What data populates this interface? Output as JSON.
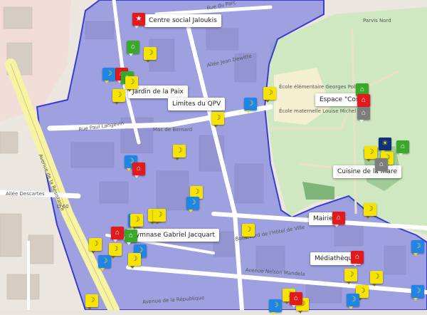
{
  "colors": {
    "zone_fill": "#5b5fe0",
    "park": "#cfe8c2",
    "road_primary": "#f6f3a4",
    "building": "#d7cfc7",
    "marker_yellow": "#f4e400",
    "marker_blue": "#1f86e6",
    "marker_red": "#e11b1b",
    "marker_green": "#3aa82a"
  },
  "labels": {
    "centre_social": "Centre social Jaloukis",
    "jardin": "Jardin de la Paix",
    "limites_cpv": "Limites du QPV",
    "espace_cosy": "Espace \"Cosy\"",
    "cuisine_mare": "Cuisine de la mare",
    "mairie": "Mairie",
    "gymnase": "Gymnase Gabriel Jacquart",
    "mediatheque": "Médiathèque"
  },
  "streets": {
    "rue_du_parc": "Rue du Parc",
    "parvis_nord": "Parvis Nord",
    "allee_jean_dewitte": "Allée Jean Dewitte",
    "rue_paul_langevin": "Rue Paul Langevin",
    "avenue_resistance": "Avenue de la Résistance",
    "allee_descartes": "Allée Descartes",
    "boulevard_hotel_ville": "Boulevard de l'Hôtel de Ville",
    "avenue_nelson_mandela": "Avenue Nelson Mandela",
    "ecole_elementaire": "École élémentaire Georges Politzer",
    "ecole_maternelle": "École maternelle Louise Michel",
    "mac_de_bernard": "Mac de Bernard",
    "d60": "D 60",
    "avenue_republique": "Avenue de la République"
  },
  "markers": [
    {
      "id": "m1",
      "color": "red",
      "icon": "star-icon"
    },
    {
      "id": "m2",
      "color": "green",
      "icon": "house-icon"
    },
    {
      "id": "m3",
      "color": "yellow",
      "icon": "banana-icon"
    },
    {
      "id": "m4",
      "color": "red",
      "icon": "house-icon"
    },
    {
      "id": "m5",
      "color": "blue",
      "icon": "banana-icon"
    },
    {
      "id": "m6",
      "color": "green",
      "icon": "house-icon"
    },
    {
      "id": "m7",
      "color": "yellow",
      "icon": "banana-icon"
    },
    {
      "id": "m8",
      "color": "yellow",
      "icon": "banana-icon"
    },
    {
      "id": "m9",
      "color": "blue",
      "icon": "banana-icon"
    },
    {
      "id": "m10",
      "color": "yellow",
      "icon": "banana-icon"
    },
    {
      "id": "m11",
      "color": "yellow",
      "icon": "banana-icon"
    },
    {
      "id": "m12",
      "color": "green",
      "icon": "house-icon"
    },
    {
      "id": "m13",
      "color": "red",
      "icon": "house-icon"
    },
    {
      "id": "m14",
      "color": "gray",
      "icon": "house-icon"
    },
    {
      "id": "m15",
      "color": "navy",
      "icon": "sun-icon"
    },
    {
      "id": "m16",
      "color": "green",
      "icon": "house-icon"
    },
    {
      "id": "m17",
      "color": "yellow",
      "icon": "banana-icon"
    },
    {
      "id": "m18",
      "color": "yellow",
      "icon": "banana-icon"
    },
    {
      "id": "m19",
      "color": "gray",
      "icon": "house-icon"
    },
    {
      "id": "m20",
      "color": "yellow",
      "icon": "banana-icon"
    },
    {
      "id": "m21",
      "color": "blue",
      "icon": "banana-icon"
    },
    {
      "id": "m22",
      "color": "red",
      "icon": "house-icon"
    },
    {
      "id": "m23",
      "color": "yellow",
      "icon": "banana-icon"
    },
    {
      "id": "m24",
      "color": "blue",
      "icon": "banana-icon"
    },
    {
      "id": "m25",
      "color": "yellow",
      "icon": "banana-icon"
    },
    {
      "id": "m26",
      "color": "blue",
      "icon": "banana-icon"
    },
    {
      "id": "m27",
      "color": "yellow",
      "icon": "banana-icon"
    },
    {
      "id": "m28",
      "color": "yellow",
      "icon": "banana-icon"
    },
    {
      "id": "m29",
      "color": "red",
      "icon": "house-icon"
    },
    {
      "id": "m30",
      "color": "green",
      "icon": "house-icon"
    },
    {
      "id": "m31",
      "color": "yellow",
      "icon": "banana-icon"
    },
    {
      "id": "m32",
      "color": "yellow",
      "icon": "banana-icon"
    },
    {
      "id": "m33",
      "color": "blue",
      "icon": "banana-icon"
    },
    {
      "id": "m34",
      "color": "blue",
      "icon": "banana-icon"
    },
    {
      "id": "m35",
      "color": "yellow",
      "icon": "banana-icon"
    },
    {
      "id": "m36",
      "color": "yellow",
      "icon": "banana-icon"
    },
    {
      "id": "m37",
      "color": "yellow",
      "icon": "banana-icon"
    },
    {
      "id": "m38",
      "color": "red",
      "icon": "house-icon"
    },
    {
      "id": "m39",
      "color": "yellow",
      "icon": "banana-icon"
    },
    {
      "id": "m40",
      "color": "red",
      "icon": "house-icon"
    },
    {
      "id": "m41",
      "color": "yellow",
      "icon": "banana-icon"
    },
    {
      "id": "m42",
      "color": "blue",
      "icon": "banana-icon"
    },
    {
      "id": "m43",
      "color": "yellow",
      "icon": "banana-icon"
    },
    {
      "id": "m44",
      "color": "yellow",
      "icon": "banana-icon"
    },
    {
      "id": "m45",
      "color": "blue",
      "icon": "banana-icon"
    },
    {
      "id": "m46",
      "color": "blue",
      "icon": "banana-icon"
    },
    {
      "id": "m47",
      "color": "yellow",
      "icon": "banana-icon"
    },
    {
      "id": "m48",
      "color": "red",
      "icon": "house-icon"
    },
    {
      "id": "m49",
      "color": "blue",
      "icon": "banana-icon"
    },
    {
      "id": "m50",
      "color": "yellow",
      "icon": "banana-icon"
    }
  ]
}
